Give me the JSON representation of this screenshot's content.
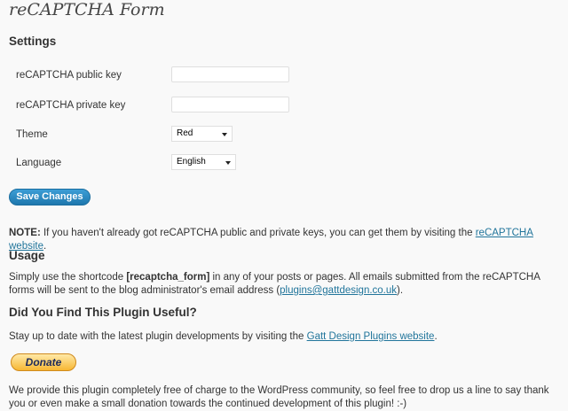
{
  "page_title": "reCAPTCHA Form",
  "settings": {
    "heading": "Settings",
    "public_key_label": "reCAPTCHA public key",
    "public_key_value": "",
    "private_key_label": "reCAPTCHA private key",
    "private_key_value": "",
    "theme_label": "Theme",
    "theme_value": "Red",
    "language_label": "Language",
    "language_value": "English",
    "save_label": "Save Changes"
  },
  "note": {
    "bold": "NOTE:",
    "text": " If you haven't already got reCAPTCHA public and private keys, you can get them by visiting the ",
    "link": "reCAPTCHA website",
    "end": "."
  },
  "usage": {
    "heading": "Usage",
    "text1": "Simply use the shortcode ",
    "shortcode": "[recaptcha_form]",
    "text2": " in any of your posts or pages. All emails submitted from the reCAPTCHA forms will be sent to the blog administrator's email address (",
    "email": "plugins@gattdesign.co.uk",
    "text3": ")."
  },
  "plugin": {
    "heading": "Did You Find This Plugin Useful?",
    "text1": "Stay up to date with the latest plugin developments by visiting the ",
    "link": "Gatt Design Plugins website",
    "text2": ".",
    "donate_label": "Donate",
    "footer_text": "We provide this plugin completely free of charge to the WordPress community, so feel free to drop us a line to say thank you or even make a small donation towards the continued development of this plugin! :-)"
  },
  "colors": {
    "link": "#21759b",
    "button": "#2a8ac4",
    "donate": "#f7b733"
  }
}
